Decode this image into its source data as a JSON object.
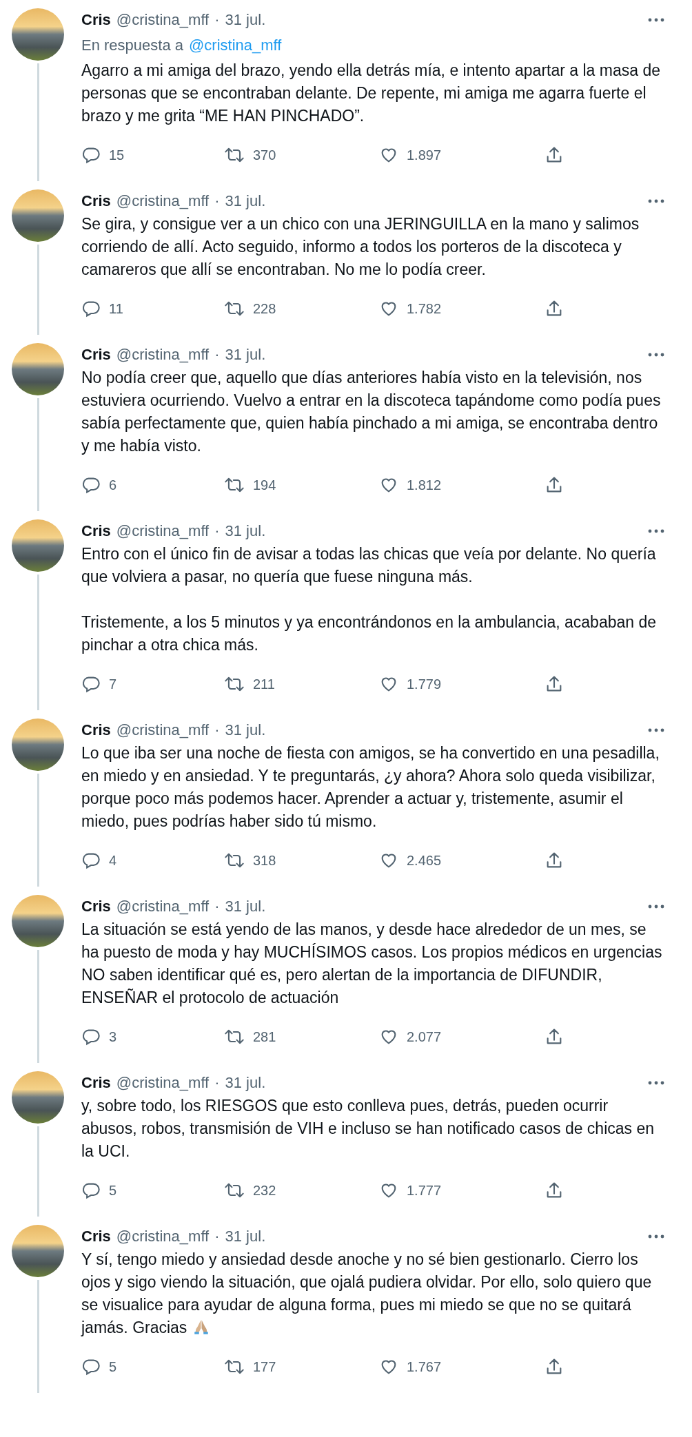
{
  "tweets": [
    {
      "name": "Cris",
      "handle": "@cristina_mff",
      "separator": "·",
      "date": "31 jul.",
      "reply_to": {
        "prefix": "En respuesta a",
        "mention": "@cristina_mff"
      },
      "paragraphs": [
        "Agarro a mi amiga del brazo, yendo ella detrás mía, e intento apartar a la masa de personas que se encontraban delante. De repente, mi amiga me agarra fuerte el brazo y me grita “ME HAN PINCHADO”."
      ],
      "emoji_after": false,
      "replies": "15",
      "retweets": "370",
      "likes": "1.897"
    },
    {
      "name": "Cris",
      "handle": "@cristina_mff",
      "separator": "·",
      "date": "31 jul.",
      "paragraphs": [
        "Se gira, y consigue ver a un chico con una JERINGUILLA en la mano y salimos corriendo de allí. Acto seguido, informo a todos los porteros de la discoteca y camareros que allí se encontraban. No me lo podía creer."
      ],
      "emoji_after": false,
      "replies": "11",
      "retweets": "228",
      "likes": "1.782"
    },
    {
      "name": "Cris",
      "handle": "@cristina_mff",
      "separator": "·",
      "date": "31 jul.",
      "paragraphs": [
        "No podía creer que, aquello que días anteriores había visto en la televisión, nos estuviera ocurriendo. Vuelvo a entrar en la discoteca tapándome como podía pues sabía perfectamente que, quien había pinchado a mi amiga, se encontraba dentro y me había visto."
      ],
      "emoji_after": false,
      "replies": "6",
      "retweets": "194",
      "likes": "1.812"
    },
    {
      "name": "Cris",
      "handle": "@cristina_mff",
      "separator": "·",
      "date": "31 jul.",
      "paragraphs": [
        "Entro con el único fin de avisar a todas las chicas que veía por delante. No quería que volviera a pasar, no quería que fuese ninguna más.",
        "Tristemente, a los 5 minutos y ya encontrándonos en la ambulancia, acababan de pinchar a otra chica más."
      ],
      "emoji_after": false,
      "replies": "7",
      "retweets": "211",
      "likes": "1.779"
    },
    {
      "name": "Cris",
      "handle": "@cristina_mff",
      "separator": "·",
      "date": "31 jul.",
      "paragraphs": [
        "Lo que iba ser una noche de fiesta con amigos, se ha convertido en una pesadilla, en miedo y en ansiedad. Y te preguntarás, ¿y ahora? Ahora solo queda visibilizar, porque poco más podemos hacer. Aprender a actuar y, tristemente, asumir el miedo, pues podrías haber sido tú mismo."
      ],
      "emoji_after": false,
      "replies": "4",
      "retweets": "318",
      "likes": "2.465"
    },
    {
      "name": "Cris",
      "handle": "@cristina_mff",
      "separator": "·",
      "date": "31 jul.",
      "paragraphs": [
        "La situación se está yendo de las manos, y desde hace alrededor de un mes, se ha puesto de moda y hay MUCHÍSIMOS casos. Los propios médicos en urgencias NO saben identificar qué es, pero alertan de la importancia de DIFUNDIR, ENSEÑAR el protocolo de actuación"
      ],
      "emoji_after": false,
      "replies": "3",
      "retweets": "281",
      "likes": "2.077"
    },
    {
      "name": "Cris",
      "handle": "@cristina_mff",
      "separator": "·",
      "date": "31 jul.",
      "paragraphs": [
        "y, sobre todo, los RIESGOS que esto conlleva pues, detrás, pueden ocurrir abusos, robos, transmisión de VIH e incluso se han notificado casos de chicas en la UCI."
      ],
      "emoji_after": false,
      "replies": "5",
      "retweets": "232",
      "likes": "1.777"
    },
    {
      "name": "Cris",
      "handle": "@cristina_mff",
      "separator": "·",
      "date": "31 jul.",
      "paragraphs": [
        "Y sí, tengo miedo y ansiedad desde anoche y no sé bien gestionarlo. Cierro los ojos y sigo viendo la situación, que ojalá pudiera olvidar. Por ello, solo quiero que se visualice para ayudar de alguna forma, pues mi miedo se que no se quitará jamás. Gracias"
      ],
      "emoji_after": true,
      "replies": "5",
      "retweets": "177",
      "likes": "1.767"
    }
  ]
}
